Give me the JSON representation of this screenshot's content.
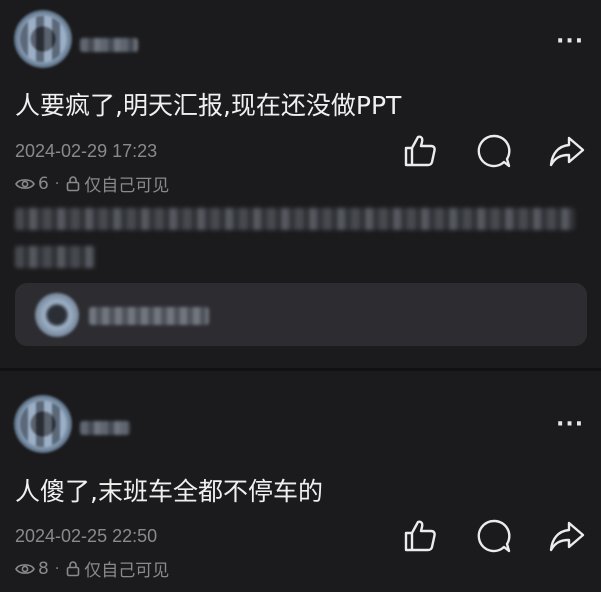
{
  "posts": [
    {
      "text": "人要疯了,明天汇报,现在还没做PPT",
      "date": "2024-02-29 17:23",
      "views": "6",
      "visibility": "仅自己可见",
      "more_label": "···"
    },
    {
      "text": "人傻了,末班车全都不停车的",
      "date": "2024-02-25 22:50",
      "views": "8",
      "visibility": "仅自己可见",
      "more_label": "···"
    }
  ],
  "separator": "·",
  "icons": {
    "more": "more-icon",
    "like": "thumbs-up-icon",
    "comment": "comment-icon",
    "share": "share-icon",
    "views": "eye-icon",
    "privacy": "lock-icon"
  },
  "colors": {
    "background": "#1b1b1d",
    "text": "#f0f0f0",
    "secondary": "#8a8a8e",
    "reply_box": "#2d2d31"
  }
}
